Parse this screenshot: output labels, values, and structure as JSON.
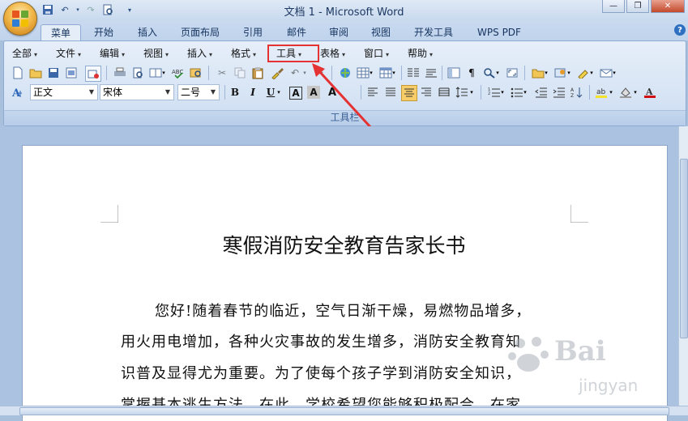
{
  "window": {
    "title": "文档 1 - Microsoft Word"
  },
  "tabs": [
    "菜单",
    "开始",
    "插入",
    "页面布局",
    "引用",
    "邮件",
    "审阅",
    "视图",
    "开发工具",
    "WPS PDF"
  ],
  "active_tab": "菜单",
  "menus": [
    "全部",
    "文件",
    "编辑",
    "视图",
    "插入",
    "格式",
    "工具",
    "表格",
    "窗口",
    "帮助"
  ],
  "highlighted_menu": "工具",
  "formatting": {
    "style": "正文",
    "font": "宋体",
    "size": "二号",
    "bold": "B",
    "italic": "I",
    "underline": "U",
    "char_border": "A",
    "char_shading": "A",
    "font_color": "A"
  },
  "ribbon_caption": "工具栏",
  "document": {
    "title": "寒假消防安全教育告家长书",
    "lines": [
      "您好!随着春节的临近，空气日渐干燥，易燃物品增多，",
      "用火用电增加，各种火灾事故的发生增多，消防安全教育知",
      "识普及显得尤为重要。为了使每个孩子学到消防安全知识，",
      "掌握基本逃生方法。在此，学校希望您能够积极配合，在家"
    ]
  },
  "watermark": {
    "text": "Bai",
    "sub": "jingyan"
  },
  "colors": {
    "highlight_box": "#e53232",
    "arrow": "#e53232",
    "highlight_yellow": "#f5e22a",
    "font_red": "#d01010"
  }
}
